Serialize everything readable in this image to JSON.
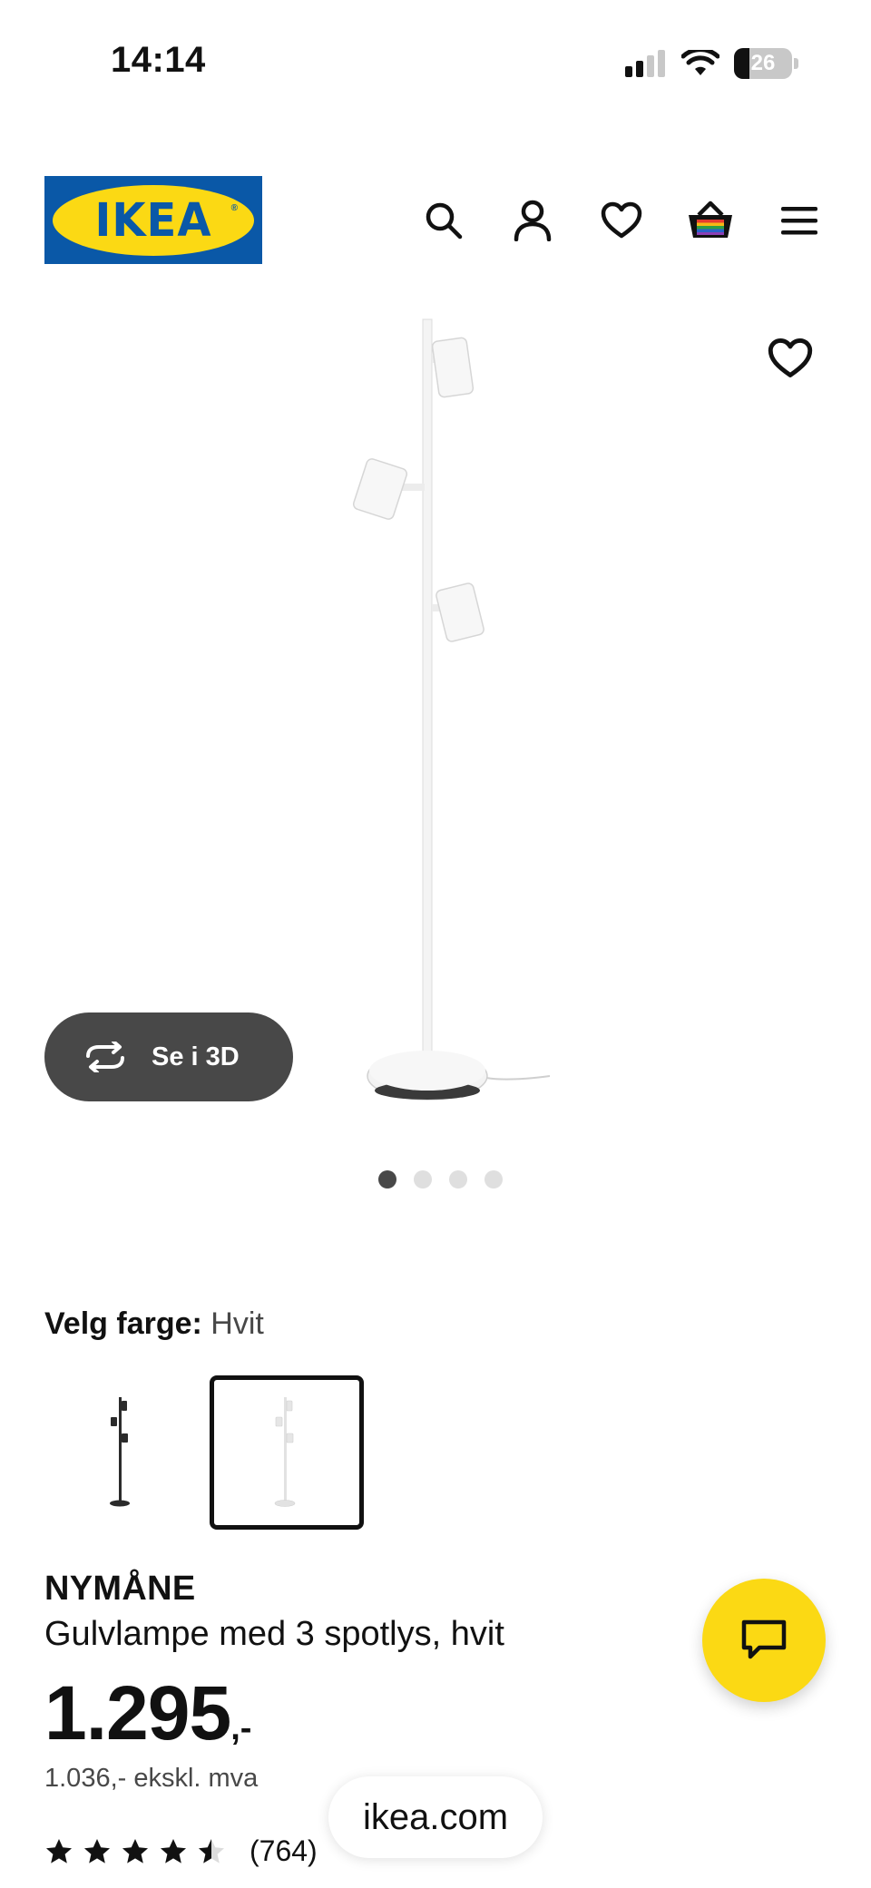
{
  "status_bar": {
    "time": "14:14",
    "battery": "26",
    "battery_level": 0.26,
    "icons": [
      "signal-icon",
      "wifi-icon",
      "battery-icon"
    ]
  },
  "header": {
    "logo_text": "IKEA",
    "icons": [
      "search-icon",
      "account-icon",
      "heart-icon",
      "basket-icon",
      "menu-icon"
    ],
    "colors": {
      "logo_blue": "#0a58a7",
      "logo_yellow": "#fbd914"
    }
  },
  "gallery": {
    "view_3d_label": "Se i 3D",
    "image_count": 4,
    "active_index": 0
  },
  "color_picker": {
    "label": "Velg farge:",
    "selected_value": "Hvit",
    "options": [
      {
        "color": "#2b2b2b",
        "selected": false
      },
      {
        "color": "#f2f2f2",
        "selected": true
      }
    ]
  },
  "product": {
    "name": "NYMÅNE",
    "description": "Gulvlampe med 3 spotlys, hvit",
    "price": "1.295",
    "price_suffix": ",-",
    "price_excl_vat": "1.036,- ekskl. mva",
    "rating": 4.5,
    "review_count": "(764)"
  },
  "browser": {
    "url": "ikea.com"
  },
  "colors": {
    "dark_button": "#484848",
    "chat_yellow": "#fbd914"
  }
}
